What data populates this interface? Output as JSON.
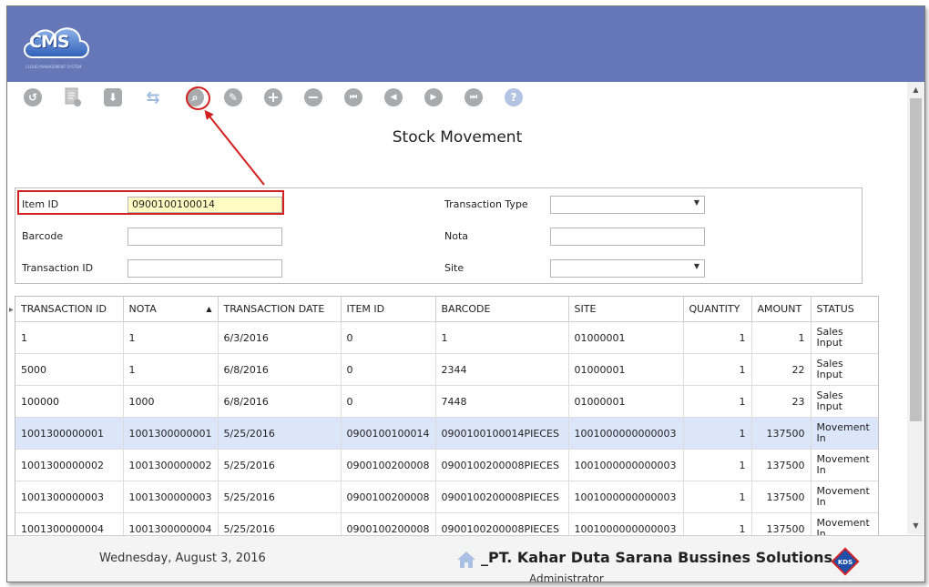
{
  "app": {
    "logo_text": "CMS",
    "logo_tagline": "CLOUD MANAGEMENT SYSTEM"
  },
  "toolbar": {
    "buttons": [
      {
        "icon": "undo-icon",
        "glyph": "↺"
      },
      {
        "icon": "report-icon",
        "glyph": ""
      },
      {
        "icon": "download-icon",
        "glyph": "⬇"
      },
      {
        "icon": "refresh-icon",
        "glyph": "⇆"
      },
      {
        "icon": "search-icon",
        "glyph": "⌕"
      },
      {
        "icon": "edit-icon",
        "glyph": "✎"
      },
      {
        "icon": "add-icon",
        "glyph": "+"
      },
      {
        "icon": "remove-icon",
        "glyph": "−"
      },
      {
        "icon": "first-record-icon",
        "glyph": "⏮"
      },
      {
        "icon": "previous-record-icon",
        "glyph": "◀"
      },
      {
        "icon": "next-record-icon",
        "glyph": "▶"
      },
      {
        "icon": "last-record-icon",
        "glyph": "⏭"
      },
      {
        "icon": "help-icon",
        "glyph": "?"
      }
    ]
  },
  "page": {
    "title": "Stock Movement"
  },
  "filters": {
    "item_id_label": "Item ID",
    "item_id_value": "0900100100014",
    "barcode_label": "Barcode",
    "barcode_value": "",
    "transaction_id_label": "Transaction ID",
    "transaction_id_value": "",
    "transaction_type_label": "Transaction Type",
    "transaction_type_value": "",
    "nota_label": "Nota",
    "nota_value": "",
    "site_label": "Site",
    "site_value": ""
  },
  "grid": {
    "columns": [
      "TRANSACTION ID",
      "NOTA",
      "TRANSACTION DATE",
      "ITEM ID",
      "BARCODE",
      "SITE",
      "QUANTITY",
      "AMOUNT",
      "STATUS"
    ],
    "sort_indicator": "▲",
    "rows": [
      {
        "transaction_id": "1",
        "nota": "1",
        "date": "6/3/2016",
        "item_id": "0",
        "barcode": "1",
        "site": "01000001",
        "quantity": "1",
        "amount": "1",
        "status": "Sales Input",
        "selected": false
      },
      {
        "transaction_id": "5000",
        "nota": "1",
        "date": "6/8/2016",
        "item_id": "0",
        "barcode": "2344",
        "site": "01000001",
        "quantity": "1",
        "amount": "22",
        "status": "Sales Input",
        "selected": false
      },
      {
        "transaction_id": "100000",
        "nota": "1000",
        "date": "6/8/2016",
        "item_id": "0",
        "barcode": "7448",
        "site": "01000001",
        "quantity": "1",
        "amount": "23",
        "status": "Sales Input",
        "selected": false
      },
      {
        "transaction_id": "1001300000001",
        "nota": "1001300000001",
        "date": "5/25/2016",
        "item_id": "0900100100014",
        "barcode": "0900100100014PIECES",
        "site": "1001000000000003",
        "quantity": "1",
        "amount": "137500",
        "status": "Movement In",
        "selected": true
      },
      {
        "transaction_id": "1001300000002",
        "nota": "1001300000002",
        "date": "5/25/2016",
        "item_id": "0900100200008",
        "barcode": "0900100200008PIECES",
        "site": "1001000000000003",
        "quantity": "1",
        "amount": "137500",
        "status": "Movement In",
        "selected": false
      },
      {
        "transaction_id": "1001300000003",
        "nota": "1001300000003",
        "date": "5/25/2016",
        "item_id": "0900100200008",
        "barcode": "0900100200008PIECES",
        "site": "1001000000000003",
        "quantity": "1",
        "amount": "137500",
        "status": "Movement In",
        "selected": false
      },
      {
        "transaction_id": "1001300000004",
        "nota": "1001300000004",
        "date": "5/25/2016",
        "item_id": "0900100200008",
        "barcode": "0900100200008PIECES",
        "site": "1001000000000003",
        "quantity": "1",
        "amount": "137500",
        "status": "Movement In",
        "selected": false
      }
    ]
  },
  "footer": {
    "date": "Wednesday, August 3, 2016",
    "company": "_PT. Kahar Duta Sarana Bussines Solutions",
    "user": "Administrator",
    "brand_logo": "KDS"
  },
  "colors": {
    "header": "#6577b7",
    "selected_row": "#dbe6fb",
    "annotation": "#d32020",
    "input_highlight": "#fffbc2"
  }
}
